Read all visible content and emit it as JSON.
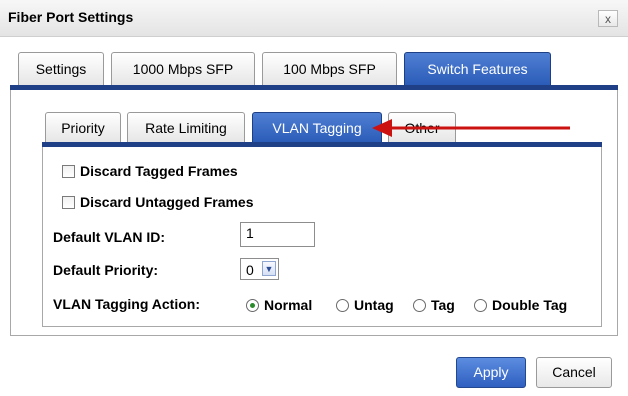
{
  "window": {
    "title": "Fiber Port Settings",
    "close_label": "x"
  },
  "outer_tabs": [
    {
      "label": "Settings"
    },
    {
      "label": "1000 Mbps SFP"
    },
    {
      "label": "100 Mbps SFP"
    },
    {
      "label": "Switch Features",
      "active": true
    }
  ],
  "inner_tabs": [
    {
      "label": "Priority"
    },
    {
      "label": "Rate Limiting"
    },
    {
      "label": "VLAN Tagging",
      "active": true
    },
    {
      "label": "Other"
    }
  ],
  "form": {
    "discard_tagged": {
      "label": "Discard Tagged Frames",
      "checked": false
    },
    "discard_untagged": {
      "label": "Discard Untagged Frames",
      "checked": false
    },
    "default_vlan_id": {
      "label": "Default VLAN ID:",
      "value": "1"
    },
    "default_priority": {
      "label": "Default Priority:",
      "value": "0"
    },
    "vlan_action": {
      "label": "VLAN Tagging Action:",
      "options": [
        "Normal",
        "Untag",
        "Tag",
        "Double Tag"
      ],
      "selected": "Normal"
    }
  },
  "buttons": {
    "apply": "Apply",
    "cancel": "Cancel"
  },
  "colors": {
    "active_tab": "#2b5cb8",
    "tab_line": "#1f3f87",
    "annotation_arrow": "#cc1111"
  }
}
